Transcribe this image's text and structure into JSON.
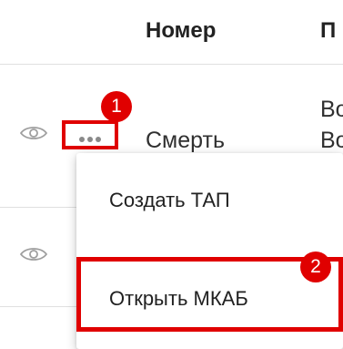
{
  "table": {
    "headers": [
      "Номер",
      "П"
    ],
    "rows": [
      {
        "type_text": "Смерть",
        "col2_line1": "Во",
        "col2_line2": "Во"
      }
    ]
  },
  "menu": {
    "items": [
      {
        "label": "Создать ТАП"
      },
      {
        "label": "Открыть МКАБ"
      }
    ]
  },
  "annotations": {
    "badge1": "1",
    "badge2": "2",
    "highlight_color": "#e00000"
  },
  "icons": [
    "eye-icon",
    "more-horizontal-icon"
  ]
}
